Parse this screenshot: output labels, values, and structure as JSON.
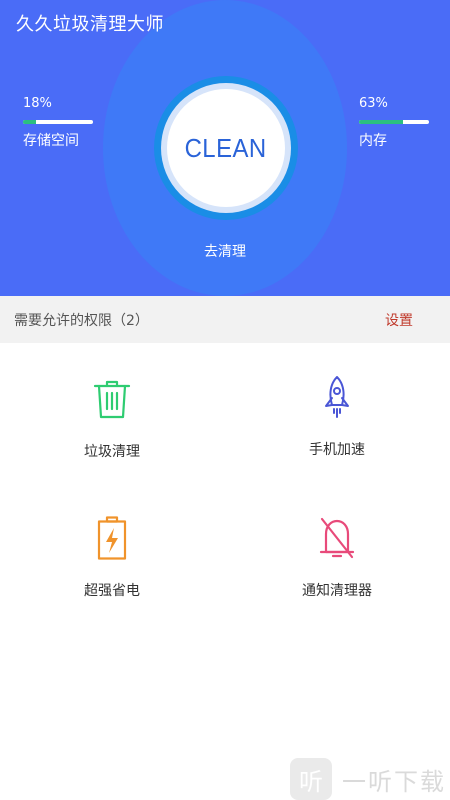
{
  "app": {
    "title": "久久垃圾清理大师"
  },
  "cleaner": {
    "button_label": "CLEAN",
    "action_label": "去清理"
  },
  "storage": {
    "percent_text": "18%",
    "percent": 18,
    "label": "存储空间"
  },
  "memory": {
    "percent_text": "63%",
    "percent": 63,
    "label": "内存"
  },
  "permissions": {
    "text": "需要允许的权限（2）",
    "action": "设置"
  },
  "features": [
    {
      "label": "垃圾清理",
      "icon": "trash-icon",
      "color": "#2ecc71"
    },
    {
      "label": "手机加速",
      "icon": "rocket-icon",
      "color": "#4a56d6"
    },
    {
      "label": "超强省电",
      "icon": "battery-icon",
      "color": "#f0932b"
    },
    {
      "label": "通知清理器",
      "icon": "bell-off-icon",
      "color": "#e84a7a"
    }
  ],
  "colors": {
    "header_bg": "#4a6cf7",
    "progress_fill": "#2bbf80",
    "settings_text": "#c0392b"
  },
  "watermark": {
    "glyph": "听",
    "text": "一听下载"
  }
}
